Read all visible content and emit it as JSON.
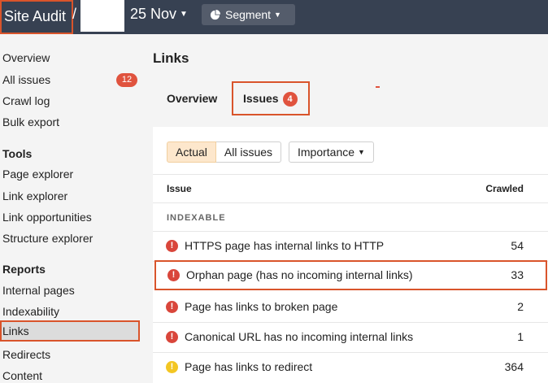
{
  "topbar": {
    "title": "Site Audit",
    "separator": "/",
    "date": "25 Nov",
    "segment_label": "Segment"
  },
  "sidebar": {
    "items": [
      {
        "label": "Overview"
      },
      {
        "label": "All issues",
        "badge": "12"
      },
      {
        "label": "Crawl log"
      },
      {
        "label": "Bulk export"
      }
    ],
    "tools_heading": "Tools",
    "tools": [
      {
        "label": "Page explorer"
      },
      {
        "label": "Link explorer"
      },
      {
        "label": "Link opportunities"
      },
      {
        "label": "Structure explorer"
      }
    ],
    "reports_heading": "Reports",
    "reports": [
      {
        "label": "Internal pages"
      },
      {
        "label": "Indexability"
      },
      {
        "label": "Links"
      },
      {
        "label": "Redirects"
      },
      {
        "label": "Content"
      }
    ]
  },
  "main": {
    "title": "Links",
    "tabs": [
      {
        "label": "Overview"
      },
      {
        "label": "Issues",
        "badge": "4"
      }
    ],
    "filters": {
      "actual": "Actual",
      "all_issues": "All issues",
      "importance": "Importance"
    },
    "table": {
      "col_issue": "Issue",
      "col_crawled": "Crawled",
      "section": "INDEXABLE",
      "rows": [
        {
          "label": "HTTPS page has internal links to HTTP",
          "count": "54",
          "severity": "error"
        },
        {
          "label": "Orphan page (has no incoming internal links)",
          "count": "33",
          "severity": "error"
        },
        {
          "label": "Page has links to broken page",
          "count": "2",
          "severity": "error"
        },
        {
          "label": "Canonical URL has no incoming internal links",
          "count": "1",
          "severity": "error"
        },
        {
          "label": "Page has links to redirect",
          "count": "364",
          "severity": "warning"
        }
      ]
    }
  },
  "colors": {
    "topbar": "#374152",
    "highlight": "#d9542b",
    "error": "#d9463b",
    "warning": "#f3c623"
  }
}
